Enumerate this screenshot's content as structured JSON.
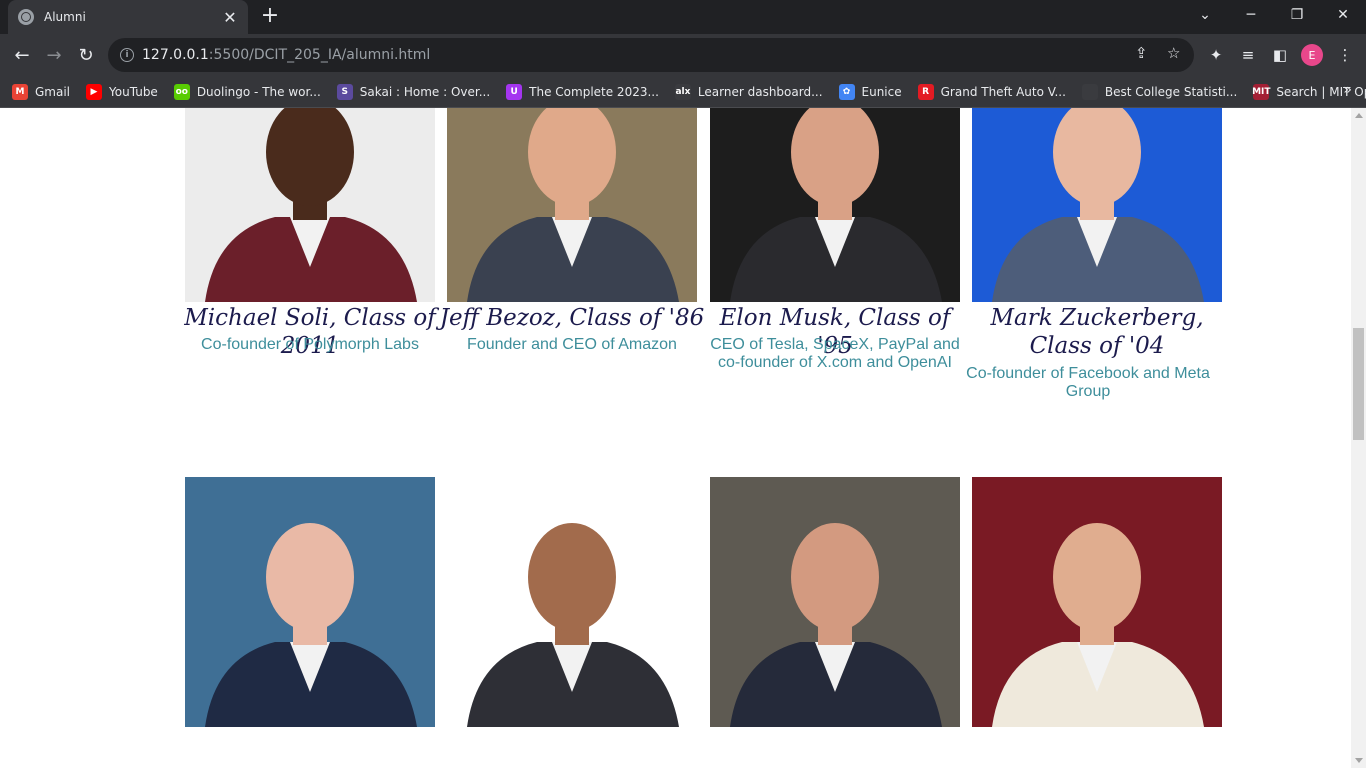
{
  "browser": {
    "tab_title": "Alumni",
    "url_host": "127.0.0.1",
    "url_path": ":5500/DCIT_205_IA/alumni.html",
    "avatar_initial": "E"
  },
  "bookmarks": [
    {
      "label": "Gmail",
      "icon": "gmail-icon",
      "color": "#ea4335",
      "glyph": "M"
    },
    {
      "label": "YouTube",
      "icon": "youtube-icon",
      "color": "#ff0000",
      "glyph": "▶"
    },
    {
      "label": "Duolingo - The wor...",
      "icon": "duolingo-icon",
      "color": "#58cc02",
      "glyph": "oo"
    },
    {
      "label": "Sakai : Home : Over...",
      "icon": "sakai-icon",
      "color": "#5b4a9e",
      "glyph": "S"
    },
    {
      "label": "The Complete 2023...",
      "icon": "udemy-icon",
      "color": "#a435f0",
      "glyph": "U"
    },
    {
      "label": "Learner dashboard...",
      "icon": "alx-icon",
      "color": "#3a3b3f",
      "glyph": "alx"
    },
    {
      "label": "Eunice",
      "icon": "google-photos-icon",
      "color": "#4285f4",
      "glyph": "✿"
    },
    {
      "label": "Grand Theft Auto V...",
      "icon": "rockstar-icon",
      "color": "#e31b23",
      "glyph": "R"
    },
    {
      "label": "Best College Statisti...",
      "icon": "college-icon",
      "color": "#3a3b3f",
      "glyph": ""
    },
    {
      "label": "Search | MIT OpenC...",
      "icon": "mit-ocw-icon",
      "color": "#a31f34",
      "glyph": "MIT"
    }
  ],
  "alumni": [
    {
      "name": "Michael Soli, Class of 2011",
      "role": "Co-founder of Polymorph Labs",
      "bg": "#ececec",
      "suit": "#6b1f2a",
      "skin": "#4a2b1c"
    },
    {
      "name": "Jeff Bezoz, Class of '86",
      "role": "Founder and CEO of Amazon",
      "bg": "#8a7a5c",
      "suit": "#3a4150",
      "skin": "#e0a98a"
    },
    {
      "name": "Elon Musk, Class of '95",
      "role": "CEO of Tesla, SpaceX, PayPal and co-founder of X.com and OpenAI",
      "bg": "#1d1d1d",
      "suit": "#2a2a2e",
      "skin": "#d9a186"
    },
    {
      "name": "Mark Zuckerberg, Class of '04",
      "role": "Co-founder of Facebook and Meta Group",
      "bg": "#1d5bd6",
      "suit": "#4d5d7a",
      "skin": "#e8b8a0"
    },
    {
      "name": "",
      "role": "",
      "bg": "#3f6f95",
      "suit": "#1f2a44",
      "skin": "#e9b9a6"
    },
    {
      "name": "",
      "role": "",
      "bg": "#ffffff",
      "suit": "#2e2f36",
      "skin": "#a26b4c"
    },
    {
      "name": "",
      "role": "",
      "bg": "#5e5a52",
      "suit": "#252a3a",
      "skin": "#d39a80"
    },
    {
      "name": "",
      "role": "",
      "bg": "#7a1a24",
      "suit": "#efe9dc",
      "skin": "#e0ad8f"
    }
  ]
}
